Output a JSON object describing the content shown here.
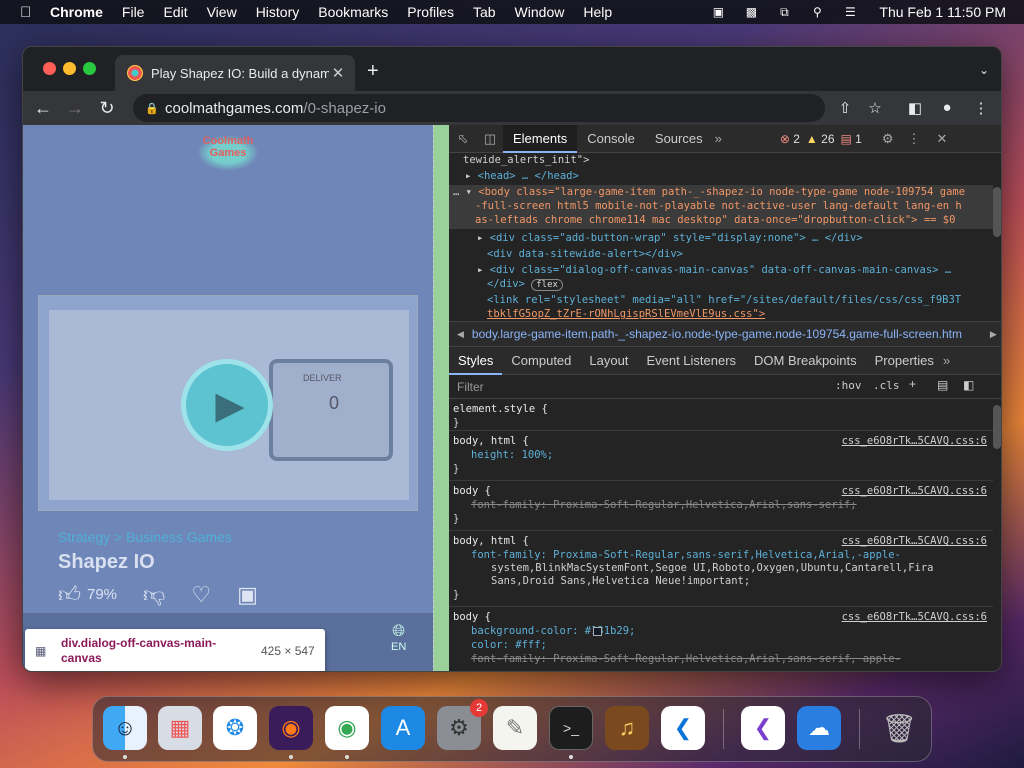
{
  "menubar": {
    "app": "Chrome",
    "items": [
      "File",
      "Edit",
      "View",
      "History",
      "Bookmarks",
      "Profiles",
      "Tab",
      "Window",
      "Help"
    ],
    "clock": "Thu Feb 1  11:50 PM"
  },
  "browser": {
    "tab_title": "Play Shapez IO: Build a dynam",
    "url_host": "coolmathgames.com",
    "url_path": "/0-shapez-io"
  },
  "page": {
    "logo_text": "Coolmath Games",
    "game_panel_label": "DELIVER",
    "game_panel_value": "0",
    "breadcrumb": "Strategy > Business Games",
    "game_title": "Shapez IO",
    "rating": "79%",
    "language": "EN"
  },
  "inspect_tooltip": {
    "selector": "div.dialog-off-canvas-main-canvas",
    "size": "425 × 547"
  },
  "devtools": {
    "tabs": [
      "Elements",
      "Console",
      "Sources"
    ],
    "active_tab": "Elements",
    "errors": "2",
    "warnings": "26",
    "issues": "1",
    "dom_lines": [
      "tewide_alerts_init\">",
      "<head> … </head>",
      "<body class=\"large-game-item path-_-shapez-io node-type-game node-109754 game",
      "-full-screen html5 mobile-not-playable not-active-user lang-default lang-en h",
      "as-leftads chrome chrome114 mac desktop\" data-once=\"dropbutton-click\"> == $0",
      "<div class=\"add-button-wrap\" style=\"display:none\"> … </div>",
      "<div data-sitewide-alert></div>",
      "<div class=\"dialog-off-canvas-main-canvas\" data-off-canvas-main-canvas> …",
      "</div>",
      "flex",
      "<link rel=\"stylesheet\" media=\"all\" href=\"/sites/default/files/css/css_f9B3T",
      "tbklfG5opZ_tZrE-rONhLgispRSlEVmeVlE9us.css\">"
    ],
    "breadcrumb": "body.large-game-item.path-_-shapez-io.node-type-game.node-109754.game-full-screen.htm",
    "styles_tabs": [
      "Styles",
      "Computed",
      "Layout",
      "Event Listeners",
      "DOM Breakpoints",
      "Properties"
    ],
    "filter_placeholder": "Filter",
    "hov": ":hov",
    "cls": ".cls",
    "rules": {
      "r0_sel": "element.style {",
      "r1_sel": "body, html {",
      "r1_p1": "height: 100%;",
      "r1_src": "css_e6O8rTk…5CAVQ.css:6",
      "r2_sel": "body {",
      "r2_p1": "font-family: Proxima-Soft-Regular,Helvetica,Arial,sans-serif;",
      "r2_src": "css_e6O8rTk…5CAVQ.css:6",
      "r3_sel": "body, html {",
      "r3_p1": "font-family: Proxima-Soft-Regular,sans-serif,Helvetica,Arial,-apple-",
      "r3_p2": "system,BlinkMacSystemFont,Segoe UI,Roboto,Oxygen,Ubuntu,Cantarell,Fira",
      "r3_p3": "Sans,Droid Sans,Helvetica Neue!important;",
      "r3_src": "css_e6O8rTk…5CAVQ.css:6",
      "r4_sel": "body {",
      "r4_p1": "background-color: #131b29;",
      "r4_p2": "color: #fff;",
      "r4_p3": "font-family: Proxima-Soft-Regular,Helvetica,Arial,sans-serif, apple-",
      "r4_src": "css_e6O8rTk…5CAVQ.css:6",
      "close_brace": "}"
    }
  }
}
